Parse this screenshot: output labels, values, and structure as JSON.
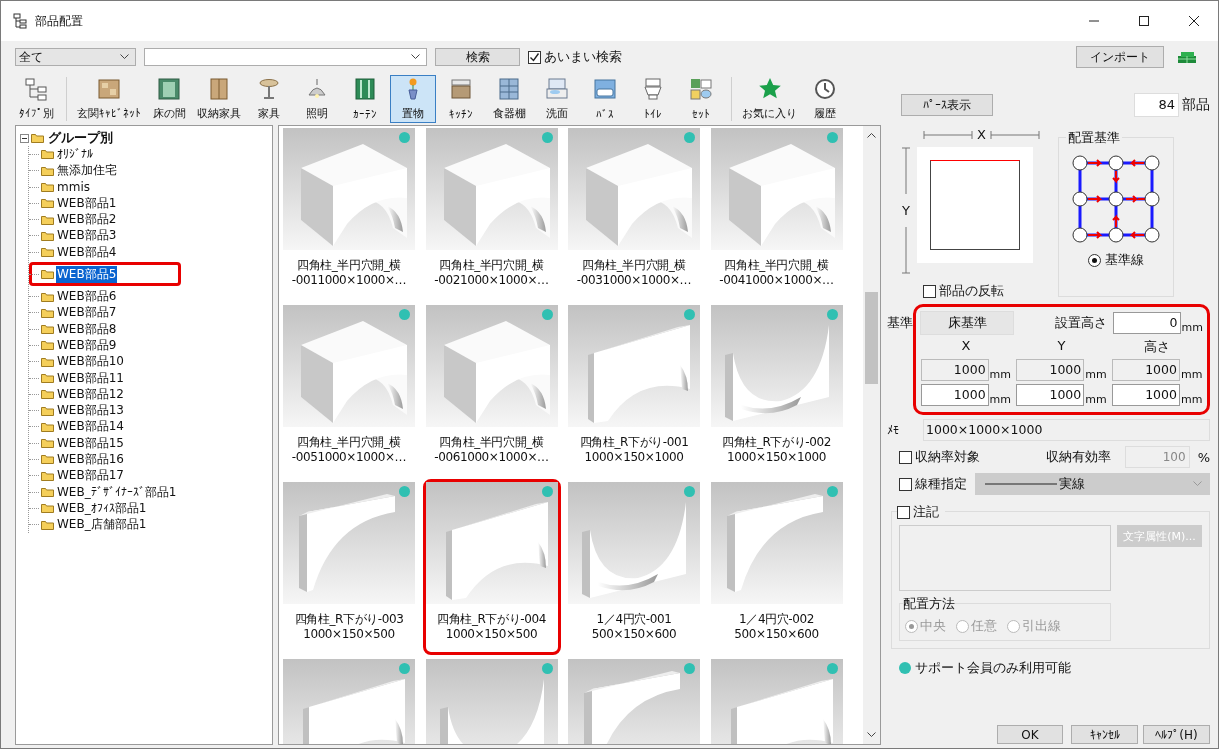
{
  "window": {
    "title": "部品配置"
  },
  "search_bar": {
    "category": "全て",
    "search_button": "検索",
    "fuzzy": {
      "label": "あいまい検索",
      "checked": true
    }
  },
  "import_button": "インポート",
  "toolbar": {
    "groups": [
      [
        {
          "label": "ﾀｲﾌﾟ別",
          "selected": false
        }
      ],
      [
        {
          "label": "玄関ｷｬﾋﾞﾈｯﾄ",
          "selected": false
        },
        {
          "label": "床の間",
          "selected": false
        },
        {
          "label": "収納家具",
          "selected": false
        },
        {
          "label": "家具",
          "selected": false
        },
        {
          "label": "照明",
          "selected": false
        },
        {
          "label": "ｶｰﾃﾝ",
          "selected": false
        },
        {
          "label": "置物",
          "selected": true
        },
        {
          "label": "ｷｯﾁﾝ",
          "selected": false
        },
        {
          "label": "食器棚",
          "selected": false
        },
        {
          "label": "洗面",
          "selected": false
        },
        {
          "label": "ﾊﾞｽ",
          "selected": false
        },
        {
          "label": "ﾄｲﾚ",
          "selected": false
        },
        {
          "label": "ｾｯﾄ",
          "selected": false
        }
      ],
      [
        {
          "label": "お気に入り",
          "selected": false
        },
        {
          "label": "履歴",
          "selected": false
        }
      ]
    ]
  },
  "preview_button": "ﾊﾟｰｽ表示",
  "part_count": {
    "value": "84",
    "unit": "部品"
  },
  "tree": {
    "label": "グループ別",
    "expanded": true,
    "children": [
      {
        "label": "ｵﾘｼﾞﾅﾙ",
        "selected": false,
        "highlighted": false
      },
      {
        "label": "無添加住宅",
        "selected": false,
        "highlighted": false
      },
      {
        "label": "mmis",
        "selected": false,
        "highlighted": false
      },
      {
        "label": "WEB部品1",
        "selected": false,
        "highlighted": false
      },
      {
        "label": "WEB部品2",
        "selected": false,
        "highlighted": false
      },
      {
        "label": "WEB部品3",
        "selected": false,
        "highlighted": false
      },
      {
        "label": "WEB部品4",
        "selected": false,
        "highlighted": false
      },
      {
        "label": "WEB部品5",
        "selected": true,
        "highlighted": true
      },
      {
        "label": "WEB部品6",
        "selected": false,
        "highlighted": false
      },
      {
        "label": "WEB部品7",
        "selected": false,
        "highlighted": false
      },
      {
        "label": "WEB部品8",
        "selected": false,
        "highlighted": false
      },
      {
        "label": "WEB部品9",
        "selected": false,
        "highlighted": false
      },
      {
        "label": "WEB部品10",
        "selected": false,
        "highlighted": false
      },
      {
        "label": "WEB部品11",
        "selected": false,
        "highlighted": false
      },
      {
        "label": "WEB部品12",
        "selected": false,
        "highlighted": false
      },
      {
        "label": "WEB部品13",
        "selected": false,
        "highlighted": false
      },
      {
        "label": "WEB部品14",
        "selected": false,
        "highlighted": false
      },
      {
        "label": "WEB部品15",
        "selected": false,
        "highlighted": false
      },
      {
        "label": "WEB部品16",
        "selected": false,
        "highlighted": false
      },
      {
        "label": "WEB部品17",
        "selected": false,
        "highlighted": false
      },
      {
        "label": "WEB_ﾃﾞｻﾞｲﾅｰｽﾞ部品1",
        "selected": false,
        "highlighted": false
      },
      {
        "label": "WEB_ｵﾌｨｽ部品1",
        "selected": false,
        "highlighted": false
      },
      {
        "label": "WEB_店舗部品1",
        "selected": false,
        "highlighted": false
      }
    ]
  },
  "parts": [
    {
      "label_lines": [
        "四角柱_半円穴開_横",
        "-0011000×1000×…"
      ],
      "support_only": true,
      "highlighted": false
    },
    {
      "label_lines": [
        "四角柱_半円穴開_横",
        "-0021000×1000×…"
      ],
      "support_only": true,
      "highlighted": false
    },
    {
      "label_lines": [
        "四角柱_半円穴開_横",
        "-0031000×1000×…"
      ],
      "support_only": true,
      "highlighted": false
    },
    {
      "label_lines": [
        "四角柱_半円穴開_横",
        "-0041000×1000×…"
      ],
      "support_only": true,
      "highlighted": false
    },
    {
      "label_lines": [
        "四角柱_半円穴開_横",
        "-0051000×1000×…"
      ],
      "support_only": true,
      "highlighted": false
    },
    {
      "label_lines": [
        "四角柱_半円穴開_横",
        "-0061000×1000×…"
      ],
      "support_only": true,
      "highlighted": false
    },
    {
      "label_lines": [
        "四角柱_R下がり-001",
        "1000×150×1000"
      ],
      "support_only": true,
      "highlighted": false
    },
    {
      "label_lines": [
        "四角柱_R下がり-002",
        "1000×150×1000"
      ],
      "support_only": true,
      "highlighted": false
    },
    {
      "label_lines": [
        "四角柱_R下がり-003",
        "1000×150×500"
      ],
      "support_only": true,
      "highlighted": false
    },
    {
      "label_lines": [
        "四角柱_R下がり-004",
        "1000×150×500"
      ],
      "support_only": true,
      "highlighted": true
    },
    {
      "label_lines": [
        "1／4円穴-001",
        "500×150×600"
      ],
      "support_only": true,
      "highlighted": false
    },
    {
      "label_lines": [
        "1／4円穴-002",
        "500×150×600"
      ],
      "support_only": true,
      "highlighted": false
    },
    {
      "support_only": true,
      "highlighted": false
    },
    {
      "support_only": true,
      "highlighted": false
    },
    {
      "support_only": true,
      "highlighted": false
    },
    {
      "support_only": true,
      "highlighted": false
    }
  ],
  "placement": {
    "x_label": "X",
    "y_label": "Y",
    "flip": {
      "label": "部品の反転",
      "checked": false
    },
    "basis": {
      "title": "配置基準",
      "option": {
        "label": "基準線",
        "selected": true
      }
    }
  },
  "dimensions": {
    "highlighted": true,
    "basis_label": "基準",
    "basis_value": "床基準",
    "height_label": "設置高さ",
    "install_height": {
      "value": "0",
      "unit": "mm"
    },
    "columns": [
      "X",
      "Y",
      "高さ"
    ],
    "original": [
      {
        "value": "1000",
        "unit": "mm"
      },
      {
        "value": "1000",
        "unit": "mm"
      },
      {
        "value": "1000",
        "unit": "mm"
      }
    ],
    "current": [
      {
        "value": "1000",
        "unit": "mm"
      },
      {
        "value": "1000",
        "unit": "mm"
      },
      {
        "value": "1000",
        "unit": "mm"
      }
    ]
  },
  "memo": {
    "label": "ﾒﾓ",
    "value": "1000×1000×1000"
  },
  "storage": {
    "checkbox": {
      "label": "収納率対象",
      "checked": false
    },
    "rate_label": "収納有効率",
    "rate": "100",
    "rate_unit": "%"
  },
  "line_type": {
    "checkbox": {
      "label": "線種指定",
      "checked": false
    },
    "value": "実線"
  },
  "annotation": {
    "checkbox": {
      "label": "注記",
      "checked": false
    },
    "disabled": true,
    "font_button": "文字属性(M)...",
    "method": {
      "title": "配置方法",
      "options": [
        {
          "label": "中央",
          "selected": true
        },
        {
          "label": "任意",
          "selected": false
        },
        {
          "label": "引出線",
          "selected": false
        }
      ]
    }
  },
  "legend": "サポート会員のみ利用可能",
  "buttons": [
    "OK",
    "ｷｬﾝｾﾙ",
    "ﾍﾙﾌﾟ(H)"
  ]
}
